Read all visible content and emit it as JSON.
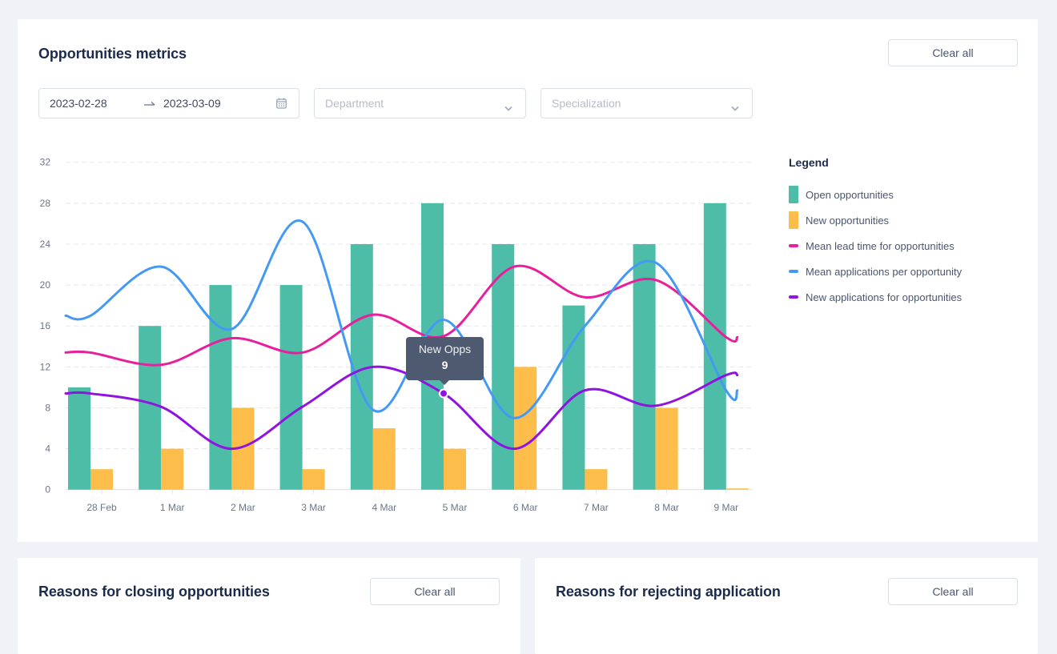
{
  "metrics": {
    "title": "Opportunities metrics",
    "clear_all": "Clear all",
    "date_range": {
      "start": "2023-02-28",
      "end": "2023-03-09",
      "separator_icon": "arrow-right-icon",
      "icon": "calendar-icon"
    },
    "department": {
      "placeholder": "Department",
      "icon": "chevron-down-icon"
    },
    "specialization": {
      "placeholder": "Specialization",
      "icon": "chevron-down-icon"
    }
  },
  "chart_data": {
    "type": "bar",
    "title": "",
    "xlabel": "",
    "ylabel": "",
    "categories": [
      "28 Feb",
      "1 Mar",
      "2 Mar",
      "3 Mar",
      "4 Mar",
      "5 Mar",
      "6 Mar",
      "7 Mar",
      "8 Mar",
      "9 Mar"
    ],
    "ylim": [
      0,
      32
    ],
    "yticks": [
      0,
      4,
      8,
      12,
      16,
      20,
      24,
      28,
      32
    ],
    "grid": true,
    "series": [
      {
        "name": "Open opportunities",
        "kind": "bar",
        "color": "#4dbda8",
        "values": [
          10,
          16,
          20,
          20,
          24,
          28,
          24,
          18,
          24,
          28
        ]
      },
      {
        "name": "New opportunities",
        "kind": "bar",
        "color": "#fcbd4b",
        "values": [
          2,
          4,
          8,
          2,
          6,
          4,
          12,
          2,
          8,
          0
        ]
      },
      {
        "name": "Mean lead time for opportunities",
        "kind": "line",
        "color": "#e91e9b",
        "values": [
          13.4,
          12.2,
          14.8,
          13.4,
          17.1,
          15.0,
          21.8,
          18.8,
          20.5,
          14.9
        ]
      },
      {
        "name": "Mean applications per opportunity",
        "kind": "line",
        "color": "#4499f4",
        "values": [
          17.0,
          21.8,
          15.7,
          26.2,
          7.8,
          16.6,
          7.0,
          16.0,
          22.2,
          9.7
        ]
      },
      {
        "name": "New applications for opportunities",
        "kind": "line",
        "color": "#9013e0",
        "values": [
          9.4,
          8.1,
          4.0,
          8.1,
          12.0,
          9.4,
          4.0,
          9.7,
          8.2,
          11.2
        ]
      }
    ],
    "legend": {
      "title": "Legend",
      "position": "right"
    },
    "tooltip": {
      "category": "5 Mar",
      "series": "New applications for opportunities",
      "label": "New Opps",
      "value": "9"
    }
  },
  "panels": [
    {
      "title": "Reasons for closing opportunities",
      "clear_all": "Clear all"
    },
    {
      "title": "Reasons for rejecting application",
      "clear_all": "Clear all"
    }
  ]
}
